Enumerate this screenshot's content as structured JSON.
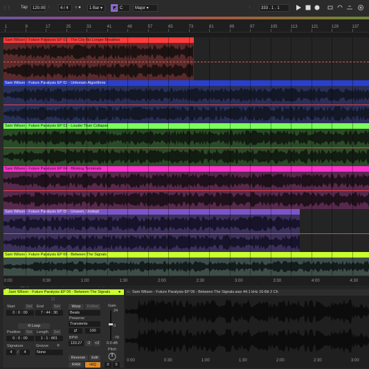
{
  "toolbar": {
    "tap": "Tap",
    "tempo": "120.00",
    "time_signature": "4 / 4",
    "metronome_dots": "○ ●",
    "quantize": "1 Bar",
    "key": "C",
    "scale": "Major",
    "position": "333 .   1 .   1"
  },
  "ruler": {
    "bars": [
      "1",
      "9",
      "17",
      "25",
      "33",
      "41",
      "49",
      "57",
      "65",
      "73",
      "81",
      "89",
      "97",
      "105",
      "113",
      "121",
      "129",
      "137"
    ]
  },
  "tracks": [
    {
      "title": "Sam Wilson - Future Paralysis EP 01 - The City No Longer Breathes",
      "color": "#ff3b3b",
      "body": "#5a2a2a",
      "bg": "#2a1f1f",
      "env": "#ff6a5a",
      "wave": "#1c1212",
      "end": 0.52
    },
    {
      "title": "Sam Wilson - Future Paralysis EP 02 - Unknown Algorithms",
      "color": "#2a3fd0",
      "body": "#283058",
      "bg": "#1d2138",
      "env": "#ff4a4a",
      "wave": "#141726",
      "end": 1.0
    },
    {
      "title": "Sam Wilson - Future Paralysis EP 03 - Louder Than Collapse",
      "color": "#7cff5a",
      "body": "#2b4a28",
      "bg": "#1a2a19",
      "env": "#ff4a4a",
      "wave": "#121c11",
      "end": 1.0
    },
    {
      "title": "Sam Wilson - Future Paralysis EP 04 - Blinking Terminals",
      "color": "#ff33cc",
      "body": "#57294c",
      "bg": "#2d1a28",
      "env": "#ff4a4a",
      "wave": "#1e111b",
      "end": 1.0
    },
    {
      "title": "Sam Wilson - Future Paralysis EP 05 - Unseen, Unslept",
      "color": "#7a55c9",
      "body": "#3b3059",
      "bg": "#221d33",
      "env": "#ff4a4a",
      "wave": "#17132a",
      "end": 0.81
    },
    {
      "title": "Sam Wilson - Future Paralysis EP 06 - Between The Signals",
      "color": "#c8ff2e",
      "body": "#3d4d4a",
      "bg": "#263230",
      "env": "#ff4a4a",
      "wave": "#141c1b",
      "end": 1.0
    }
  ],
  "timeline": {
    "labels": [
      "0:00",
      "0:30",
      "1:00",
      "1:30",
      "2:00",
      "2:30",
      "3:00",
      "3:30",
      "4:00",
      "4:30"
    ]
  },
  "clip": {
    "title": "Sam Wilson - Future Paralysis EP 06 - Between The Signals",
    "start_label": "Start",
    "set1": "Set",
    "end_label": "End",
    "set2": "Set",
    "start_value": "0 : 0 : 00",
    "end_value": "7 : 44 : 30",
    "loop": "Loop",
    "position_label": "Position",
    "set3": "Set",
    "length_label": "Length",
    "set4": "Set",
    "position_value": "0 : 0 : 00",
    "length_value": "1 : 1 : 801",
    "signature_label": "Signature",
    "sig_num": "4",
    "sig_den": "4",
    "groove_label": "Groove",
    "groove_value": "None",
    "warp": "Warp",
    "follow": "Follow",
    "warp_mode": "Beats",
    "preserve_label": "Preserve",
    "preserve_value": "Transients",
    "loop_mode": "⇄",
    "grain": "100",
    "bpm_label": "BPM",
    "bpm_value": "133.27",
    "half": ":2",
    "double": "×2",
    "reverse": "Reverse",
    "edit": "Edit",
    "ram": "RAM",
    "hiq": "HiQ",
    "gain_label": "Gain",
    "gain_top": "24",
    "gain_zero": "0",
    "gain_bottom": "-70",
    "gain_value": "0.0 dB",
    "pitch_label": "Pitch",
    "pitch_semi": "0",
    "pitch_fine": "0"
  },
  "sample": {
    "title": "Sam Wilson - Future Paralysis EP 06 - Between The Signals.wav   44.1 kHz  16-Bit  2 Ch",
    "labels": [
      "0:00",
      "0:30",
      "1:00",
      "1:30",
      "2:00",
      "2:30",
      "3:00"
    ]
  }
}
